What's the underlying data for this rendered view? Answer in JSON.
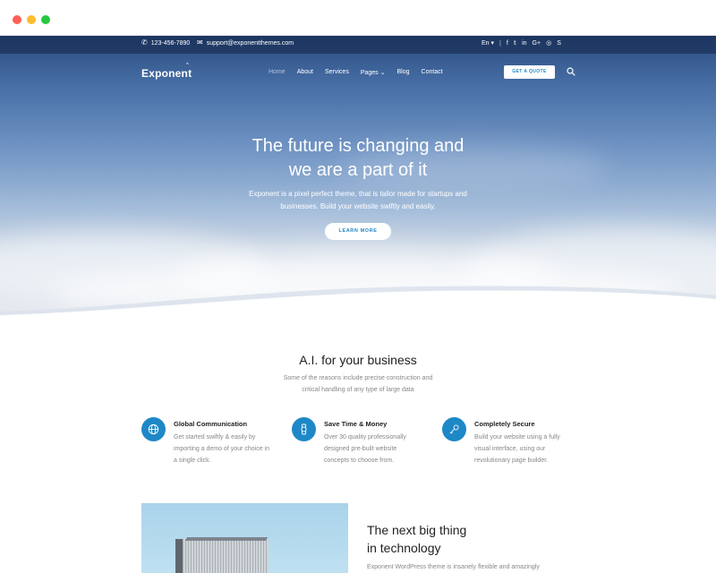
{
  "topbar": {
    "phone": "123-456-7890",
    "email": "support@exponentthemes.com",
    "language": "En",
    "socials": [
      "f",
      "𝕥",
      "in",
      "G+",
      "◎",
      "S"
    ]
  },
  "nav": {
    "logo": "Exponent",
    "items": [
      "Home",
      "About",
      "Services",
      "Pages",
      "Blog",
      "Contact"
    ],
    "cta": "GET A QUOTE"
  },
  "hero": {
    "title_line1": "The future is changing and",
    "title_line2": "we are a part of it",
    "sub_line1": "Exponent is a pixel perfect theme, that is tailor made for startups and",
    "sub_line2": "businesses. Build your website swiftly and easily.",
    "button": "LEARN MORE"
  },
  "features_section": {
    "title": "A.I. for your business",
    "sub_line1": "Some of the reasons include precise construction and",
    "sub_line2": "critical handling of any type of large data",
    "items": [
      {
        "title": "Global Communication",
        "icon": "globe-icon",
        "text": "Get started swiftly & easily by importing a demo of your choice in a single click."
      },
      {
        "title": "Save Time & Money",
        "icon": "watch-icon",
        "text": "Over 30 quality professionally designed pre-built website concepts to choose from."
      },
      {
        "title": "Completely Secure",
        "icon": "key-icon",
        "text": "Build your website using a fully visual interface, using our revolutionary page builder."
      }
    ]
  },
  "promo": {
    "title_line1": "The next big thing",
    "title_line2": "in technology",
    "text": "Exponent WordPress theme is insanely flexible and amazingly"
  },
  "colors": {
    "accent": "#1e88c7"
  }
}
